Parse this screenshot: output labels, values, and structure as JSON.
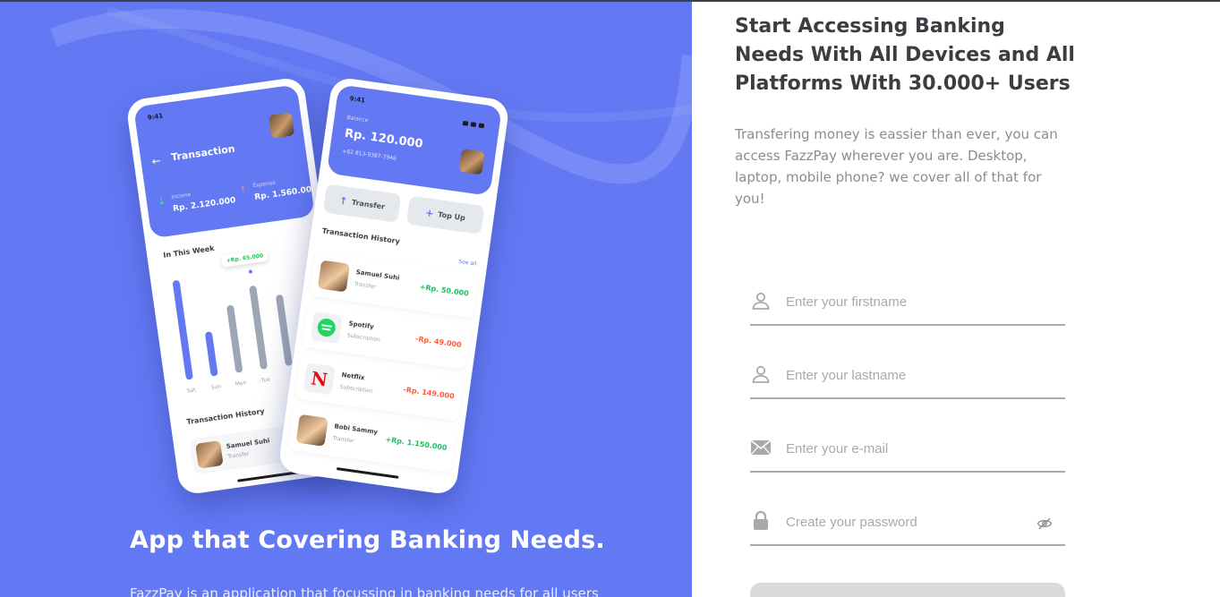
{
  "hero": {
    "title": "App that Covering Banking Needs.",
    "description": "FazzPay is an application that focussing in banking needs for all users",
    "background_color": "#6379f4"
  },
  "phone_left": {
    "time": "9:41",
    "title": "Transaction",
    "income_label": "Income",
    "income_value": "Rp. 2.120.000",
    "expense_label": "Expense",
    "expense_value": "Rp. 1.560.000",
    "section_week": "In This Week",
    "chart_tooltip": "+Rp. 65.000",
    "days": [
      "Sat",
      "Sun",
      "Mon",
      "Tue"
    ],
    "section_history": "Transaction History",
    "row": {
      "name": "Samuel Suhi",
      "type": "Transfer"
    }
  },
  "phone_right": {
    "time": "9:41",
    "balance_label": "Balance",
    "balance_value": "Rp. 120.000",
    "phone_number": "+62 813-9387-7946",
    "transfer_label": "Transfer",
    "topup_label": "Top Up",
    "history_title": "Transaction History",
    "see_all": "See all",
    "transactions": [
      {
        "name": "Samuel Suhi",
        "type": "Transfer",
        "amount": "+Rp. 50.000"
      },
      {
        "name": "Spotify",
        "type": "Subscription",
        "amount": "-Rp. 49.000"
      },
      {
        "name": "Netflix",
        "type": "Subscription",
        "amount": "-Rp. 149.000"
      },
      {
        "name": "Bobi Sammy",
        "type": "Transfer",
        "amount": "+Rp. 1.150.000"
      }
    ]
  },
  "form": {
    "title": "Start Accessing Banking Needs With All Devices and All Platforms With 30.000+ Users",
    "description": "Transfering money is eassier than ever, you can access FazzPay wherever you are. Desktop, laptop, mobile phone? we cover all of that for you!",
    "firstname_placeholder": "Enter your firstname",
    "lastname_placeholder": "Enter your lastname",
    "email_placeholder": "Enter your e-mail",
    "password_placeholder": "Create your password",
    "icons": [
      "person-icon",
      "person-icon",
      "mail-icon",
      "lock-icon",
      "eye-off-icon"
    ]
  }
}
